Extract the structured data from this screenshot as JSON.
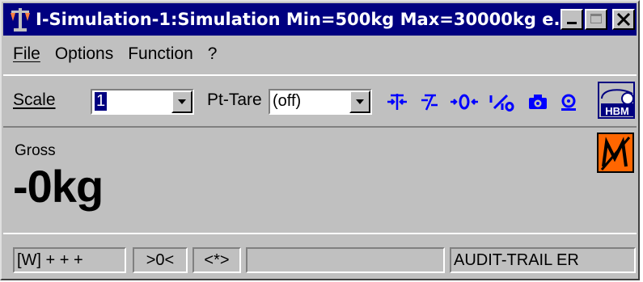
{
  "window": {
    "title": "I-Simulation-1:Simulation Min=500kg Max=30000kg e...",
    "icon": "scale-balance-icon"
  },
  "menu": {
    "file": "File",
    "options": "Options",
    "function": "Function",
    "help": "?"
  },
  "toolbar": {
    "scale_label": "Scale",
    "scale_value": "1",
    "pttare_label": "Pt-Tare",
    "pttare_value": "(off)",
    "icons": [
      "tare-icon",
      "clear-tare-icon",
      "zero-icon",
      "tenfold-resolution-icon",
      "camera-icon",
      "print-icon"
    ],
    "logo_text": "HBM"
  },
  "display": {
    "gross_label": "Gross",
    "weight": "-0kg"
  },
  "status": {
    "p1": "[W] + + +",
    "p2": ">0<",
    "p3": "<*>",
    "p4": "",
    "p5": "AUDIT-TRAIL ER"
  },
  "colors": {
    "titlebar": "#000080",
    "toolbar_icons": "#0000ff",
    "logo_orange": "#ff6600",
    "logo_navy": "#000080"
  }
}
